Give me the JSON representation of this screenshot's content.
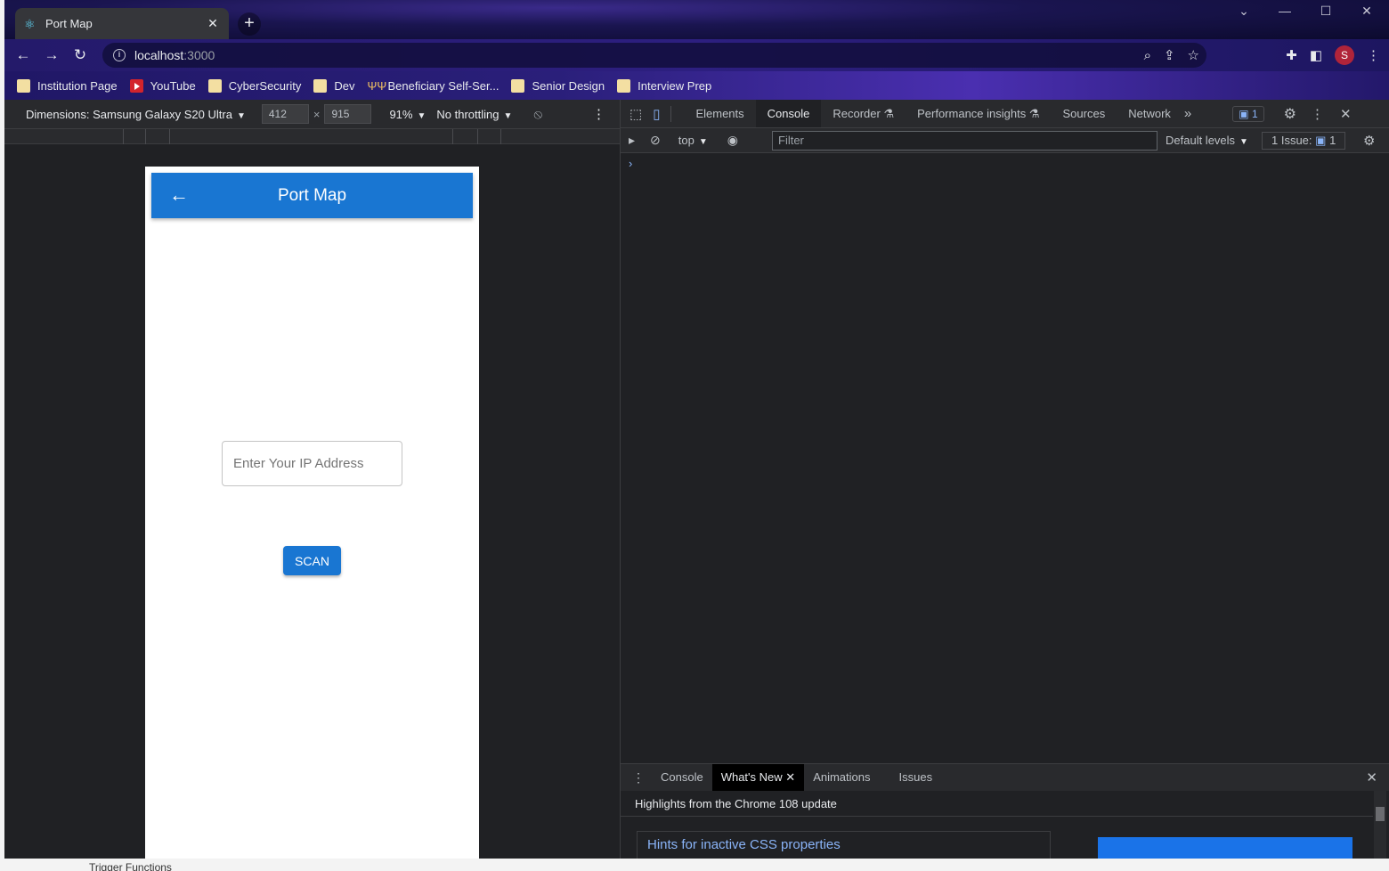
{
  "browser": {
    "tab_title": "Port Map",
    "url_host": "localhost",
    "url_port": ":3000",
    "bookmarks": [
      "Institution Page",
      "YouTube",
      "CyberSecurity",
      "Dev",
      "Beneficiary Self-Ser...",
      "Senior Design",
      "Interview Prep"
    ],
    "profile_initial": "S"
  },
  "device_toolbar": {
    "dimensions_label": "Dimensions: Samsung Galaxy S20 Ultra",
    "width": "412",
    "height": "915",
    "zoom": "91%",
    "throttling": "No throttling"
  },
  "app": {
    "title": "Port Map",
    "ip_placeholder": "Enter Your IP Address",
    "scan_label": "SCAN"
  },
  "devtools": {
    "tabs": [
      "Elements",
      "Console",
      "Recorder",
      "Performance insights",
      "Sources",
      "Network"
    ],
    "issue_count": "1",
    "context": "top",
    "filter_placeholder": "Filter",
    "levels": "Default levels",
    "issues_label": "1 Issue:",
    "issues_count": "1",
    "drawer_tabs": [
      "Console",
      "What's New",
      "Animations",
      "Issues"
    ],
    "whats_new_heading": "Highlights from the Chrome 108 update",
    "hint_title": "Hints for inactive CSS properties"
  },
  "background": {
    "trigger_text": "Trigger Functions"
  }
}
